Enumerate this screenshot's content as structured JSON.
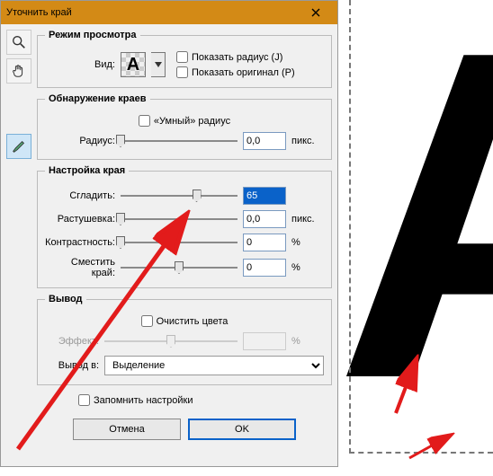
{
  "window": {
    "title": "Уточнить край"
  },
  "viewMode": {
    "legend": "Режим просмотра",
    "view_label": "Вид:",
    "swatch_letter": "A",
    "show_radius": "Показать радиус (J)",
    "show_original": "Показать оригинал (P)"
  },
  "edgeDetect": {
    "legend": "Обнаружение краев",
    "smart_radius": "«Умный» радиус",
    "radius_label": "Радиус:",
    "radius_value": "0,0",
    "radius_unit": "пикс."
  },
  "adjust": {
    "legend": "Настройка края",
    "smooth_label": "Сгладить:",
    "smooth_value": "65",
    "feather_label": "Растушевка:",
    "feather_value": "0,0",
    "feather_unit": "пикс.",
    "contrast_label": "Контрастность:",
    "contrast_value": "0",
    "shift_label": "Сместить край:",
    "shift_value": "0",
    "percent": "%"
  },
  "output": {
    "legend": "Вывод",
    "decontaminate": "Очистить цвета",
    "effect_label": "Эффект:",
    "output_to_label": "Вывод в:",
    "output_option": "Выделение"
  },
  "remember": "Запомнить настройки",
  "buttons": {
    "cancel": "Отмена",
    "ok": "OK"
  }
}
